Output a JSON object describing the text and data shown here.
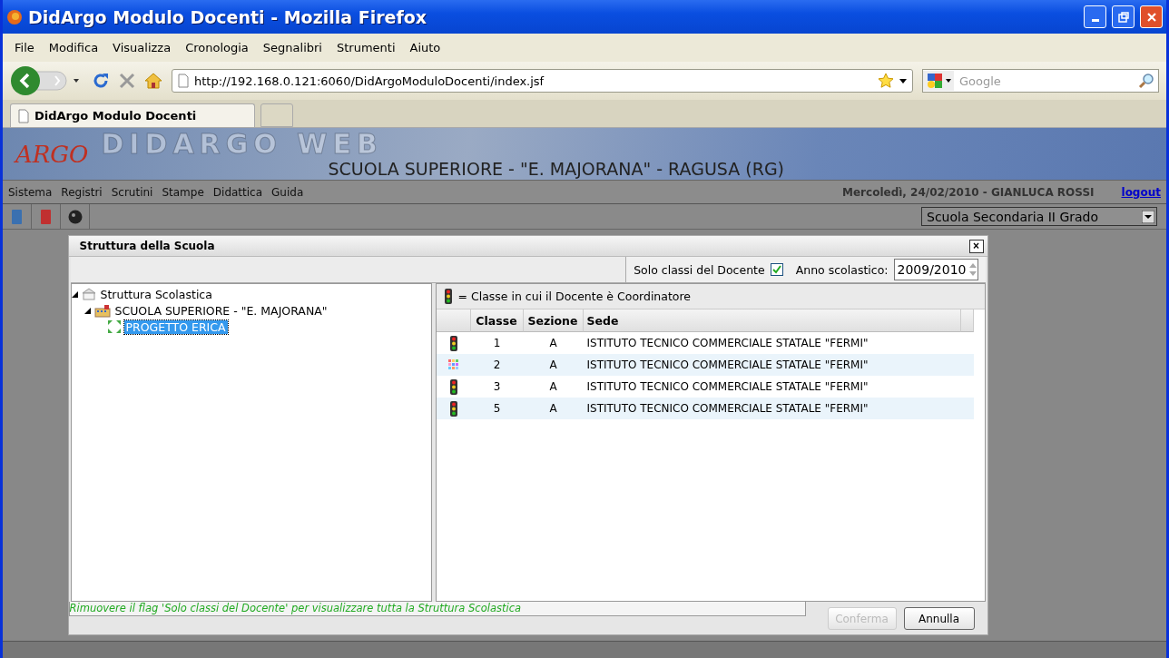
{
  "window": {
    "title": "DidArgo Modulo Docenti - Mozilla Firefox"
  },
  "menu": [
    "File",
    "Modifica",
    "Visualizza",
    "Cronologia",
    "Segnalibri",
    "Strumenti",
    "Aiuto"
  ],
  "address_bar": {
    "value": "http://192.168.0.121:6060/DidArgoModuloDocenti/index.jsf"
  },
  "search": {
    "placeholder": "Google"
  },
  "tabs": [
    {
      "label": "DidArgo Modulo Docenti",
      "selected": true
    }
  ],
  "app": {
    "logo": "ARGO",
    "banner": "DIDARGO WEB",
    "school": "SCUOLA SUPERIORE - \"E. MAJORANA\" - RAGUSA (RG)",
    "menu": [
      "Sistema",
      "Registri",
      "Scrutini",
      "Stampe",
      "Didattica",
      "Guida"
    ],
    "user_info": "Mercoledì, 24/02/2010 - GIANLUCA ROSSI",
    "logout": "logout",
    "school_type": "Scuola Secondaria II Grado"
  },
  "dialog": {
    "title": "Struttura della Scuola",
    "close": "×",
    "only_teacher_classes": {
      "label": "Solo classi del Docente",
      "checked": true
    },
    "year": {
      "label": "Anno scolastico:",
      "value": "2009/2010"
    },
    "tree": [
      {
        "label": "Struttura Scolastica",
        "expanded": true,
        "selected": false,
        "children": [
          {
            "label": "SCUOLA SUPERIORE - \"E. MAJORANA\"",
            "expanded": true,
            "selected": false,
            "children": [
              {
                "label": "PROGETTO ERICA",
                "selected": true
              }
            ]
          }
        ]
      }
    ],
    "legend": "= Classe in cui il Docente è Coordinatore",
    "table": {
      "columns": [
        "Classe",
        "Sezione",
        "Sede"
      ],
      "rows": [
        {
          "coordinator": true,
          "cells": [
            "1",
            "A",
            "ISTITUTO TECNICO COMMERCIALE STATALE \"FERMI\""
          ]
        },
        {
          "coordinator": false,
          "cells": [
            "2",
            "A",
            "ISTITUTO TECNICO COMMERCIALE STATALE \"FERMI\""
          ]
        },
        {
          "coordinator": true,
          "cells": [
            "3",
            "A",
            "ISTITUTO TECNICO COMMERCIALE STATALE \"FERMI\""
          ]
        },
        {
          "coordinator": true,
          "cells": [
            "5",
            "A",
            "ISTITUTO TECNICO COMMERCIALE STATALE \"FERMI\""
          ]
        }
      ]
    },
    "hint": "Rimuovere il flag 'Solo classi del Docente' per visualizzare tutta la Struttura Scolastica",
    "buttons": [
      {
        "label": "Conferma",
        "disabled": true
      },
      {
        "label": "Annulla",
        "disabled": false
      }
    ]
  }
}
